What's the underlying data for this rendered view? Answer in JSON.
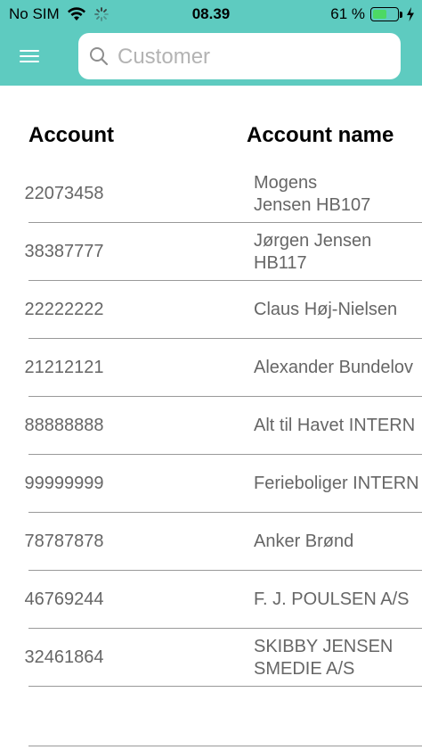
{
  "status_bar": {
    "carrier": "No SIM",
    "time": "08.39",
    "battery_percent": "61 %",
    "battery_level": 0.61,
    "battery_color": "#4cd964"
  },
  "nav": {
    "background_color": "#5ecbc0",
    "menu_icon": "hamburger-menu-icon",
    "search_icon": "search-icon",
    "search_placeholder": "Customer",
    "search_value": ""
  },
  "table": {
    "headers": {
      "account": "Account",
      "account_name": "Account name"
    },
    "rows": [
      {
        "account": "22073458",
        "name": "Mogens\nJensen HB107"
      },
      {
        "account": "38387777",
        "name": "Jørgen Jensen\nHB117"
      },
      {
        "account": "22222222",
        "name": "Claus Høj-Nielsen"
      },
      {
        "account": "21212121",
        "name": "Alexander Bundelov"
      },
      {
        "account": "88888888",
        "name": "Alt til Havet INTERN"
      },
      {
        "account": "99999999",
        "name": "Ferieboliger INTERN"
      },
      {
        "account": "78787878",
        "name": "Anker Brønd"
      },
      {
        "account": "46769244",
        "name": "F. J. POULSEN A/S"
      },
      {
        "account": "32461864",
        "name": "SKIBBY JENSEN\nSMEDIE A/S"
      }
    ]
  }
}
